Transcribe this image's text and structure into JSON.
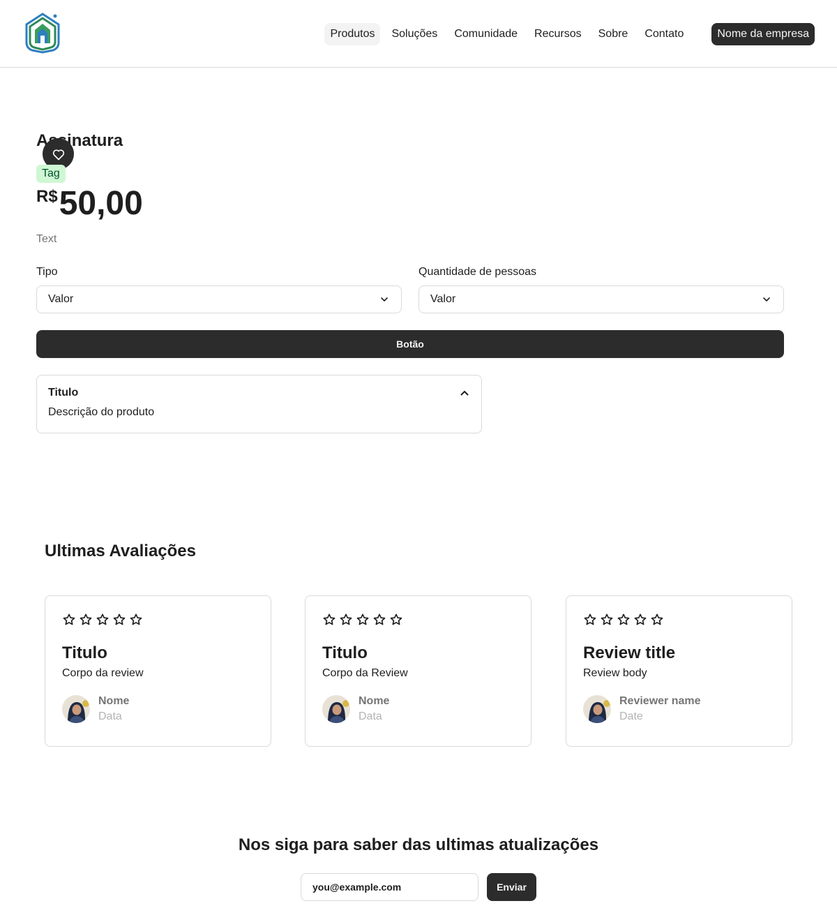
{
  "header": {
    "logo_icon": "house-logo-icon",
    "nav": [
      {
        "label": "Produtos",
        "active": true
      },
      {
        "label": "Soluções"
      },
      {
        "label": "Comunidade"
      },
      {
        "label": "Recursos"
      },
      {
        "label": "Sobre"
      },
      {
        "label": "Contato"
      }
    ],
    "company_button": "Nome da empresa"
  },
  "product": {
    "title": "Assinatura",
    "favorite_icon": "heart-icon",
    "tag": "Tag",
    "currency": "R$",
    "price": "50,00",
    "text": "Text",
    "fields": [
      {
        "label": "Tipo",
        "value": "Valor"
      },
      {
        "label": "Quantidade de pessoas",
        "value": "Valor"
      }
    ],
    "button": "Botão",
    "accordion": {
      "title": "Titulo",
      "body": "Descrição do produto",
      "icon": "chevron-up-icon"
    }
  },
  "reviews": {
    "heading": "Ultimas Avaliações",
    "items": [
      {
        "stars": 5,
        "title": "Titulo",
        "body": "Corpo da review",
        "name": "Nome",
        "date": "Data"
      },
      {
        "stars": 5,
        "title": "Titulo",
        "body": "Corpo da Review",
        "name": "Nome",
        "date": "Data"
      },
      {
        "stars": 5,
        "title": "Review title",
        "body": "Review body",
        "name": "Reviewer name",
        "date": "Date"
      }
    ]
  },
  "newsletter": {
    "heading": "Nos siga para saber das ultimas atualizações",
    "placeholder": "you@example.com",
    "button": "Enviar"
  },
  "colors": {
    "primary": "#2c2c2c",
    "border": "#d9d9d9",
    "tag_bg": "#cff7d3",
    "tag_text": "#02542d",
    "logo_blue": "#2d7fc1",
    "logo_green": "#2e8b57"
  }
}
